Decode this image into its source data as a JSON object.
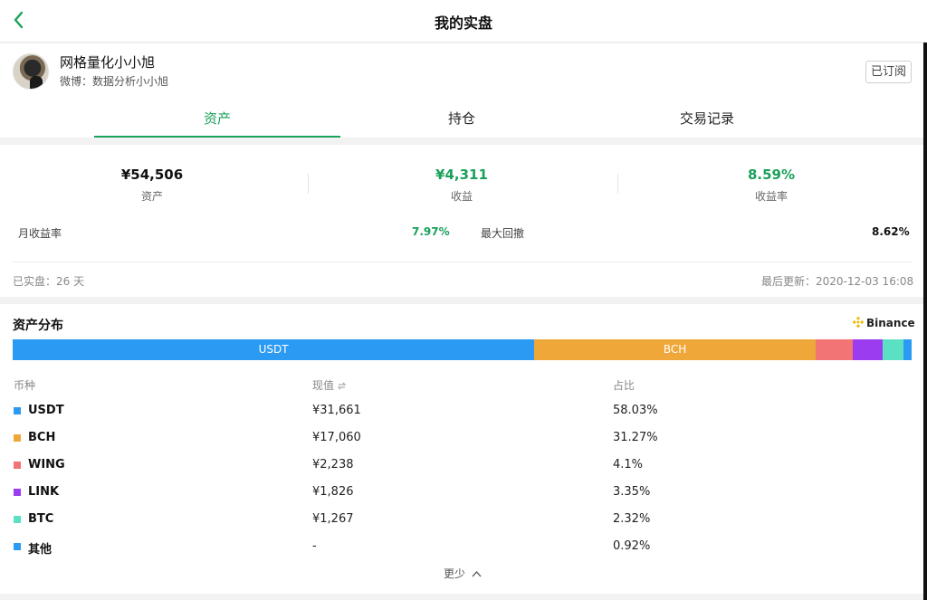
{
  "header": {
    "title": "我的实盘",
    "back_icon": "chevron-left-icon"
  },
  "colors": {
    "accent": "#1aa05a",
    "usdt": "#2b9af3",
    "bch": "#f0a73a",
    "wing": "#f27474",
    "link": "#9b3cf0",
    "btc": "#5ce0c4",
    "other": "#2b9af3"
  },
  "profile": {
    "name": "网格量化小小旭",
    "weibo": "微博：数据分析小小旭",
    "subscribe_label": "已订阅"
  },
  "tabs": [
    {
      "label": "资产"
    },
    {
      "label": "持仓"
    },
    {
      "label": "交易记录"
    }
  ],
  "stats": {
    "assets": {
      "value": "¥54,506",
      "label": "资产"
    },
    "profit": {
      "value": "¥4,311",
      "label": "收益"
    },
    "profit_rate": {
      "value": "8.59%",
      "label": "收益率"
    },
    "monthly_label": "月收益率",
    "monthly_value": "7.97%",
    "drawdown_label": "最大回撤",
    "drawdown_value": "8.62%",
    "days_text": "已实盘：26 天",
    "updated_text": "最后更新：2020-12-03 16:08"
  },
  "distribution": {
    "title": "资产分布",
    "exchange": "Binance",
    "exchange_icon": "binance-logo-icon",
    "headers": {
      "coin": "币种",
      "value": "现值",
      "sort_icon": "swap-arrows-icon",
      "ratio": "占比"
    },
    "bar_labels": {
      "usdt": "USDT",
      "bch": "BCH"
    },
    "items": [
      {
        "coin": "USDT",
        "value": "¥31,661",
        "pct": "58.03%",
        "share": 58.03
      },
      {
        "coin": "BCH",
        "value": "¥17,060",
        "pct": "31.27%",
        "share": 31.27
      },
      {
        "coin": "WING",
        "value": "¥2,238",
        "pct": "4.1%",
        "share": 4.1
      },
      {
        "coin": "LINK",
        "value": "¥1,826",
        "pct": "3.35%",
        "share": 3.35
      },
      {
        "coin": "BTC",
        "value": "¥1,267",
        "pct": "2.32%",
        "share": 2.32
      },
      {
        "coin": "其他",
        "value": "-",
        "pct": "0.92%",
        "share": 0.92
      }
    ],
    "less_label": "更少"
  }
}
